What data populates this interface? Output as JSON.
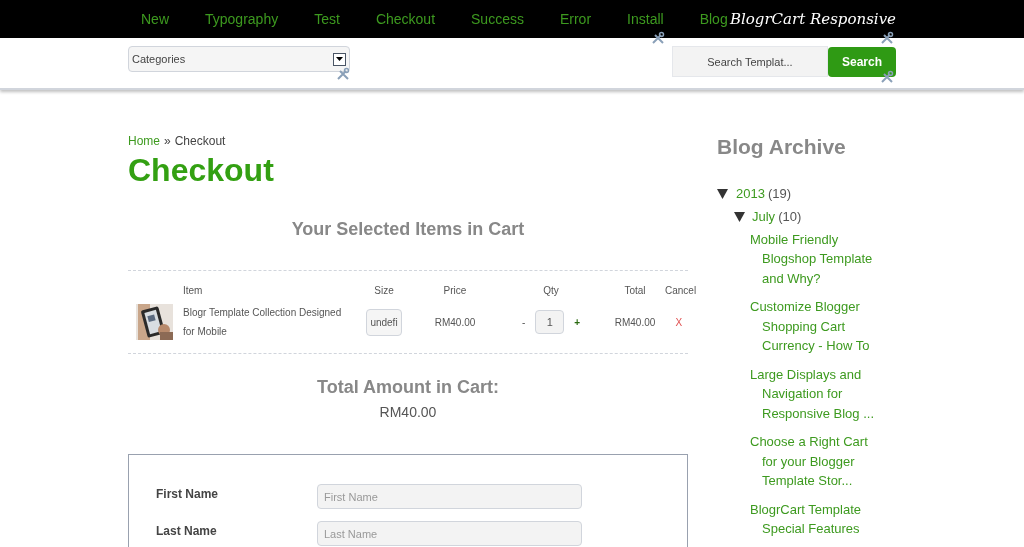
{
  "nav": {
    "links": [
      "New",
      "Typography",
      "Test",
      "Checkout",
      "Success",
      "Error",
      "Install",
      "Blog"
    ],
    "logo": "BlogrCart Responsive"
  },
  "toolbar": {
    "category_select": {
      "value": "Categories"
    },
    "search": {
      "placeholder": "Search Templat...",
      "button": "Search"
    }
  },
  "breadcrumb": {
    "links": [
      "Home"
    ],
    "separator": "»",
    "current": "Checkout"
  },
  "page_title": "Checkout",
  "cart": {
    "heading": "Your Selected Items in Cart",
    "columns": [
      "Item",
      "Size",
      "Price",
      "Qty",
      "Total",
      "Cancel"
    ],
    "rows": [
      {
        "kind": "picture",
        "item": "Blogr Template Collection Designed for Mobile",
        "size": "undefi",
        "price": "RM40.00",
        "decrement": "-",
        "qty": "1",
        "increment": "+",
        "total": "RM40.00",
        "remove": "X"
      }
    ],
    "total_label": "Total Amount in Cart:",
    "total": "RM40.00"
  },
  "form": {
    "fields": [
      {
        "label": "First Name",
        "placeholder": "First Name"
      },
      {
        "label": "Last Name",
        "placeholder": "Last Name"
      }
    ]
  },
  "sidebar": {
    "title": "Blog Archive",
    "archive": [
      {
        "label": "2013",
        "count": "(19)",
        "expanded": true,
        "children": [
          {
            "label": "July",
            "count": "(10)",
            "expanded": true,
            "posts": [
              "Mobile Friendly Blogshop Template and Why?",
              "Customize Blogger Shopping Cart Currency - How To",
              "Large Displays and Navigation for Responsive Blog ...",
              "Choose a Right Cart for your Blogger Template Stor...",
              "BlogrCart Template Special Features"
            ]
          }
        ]
      }
    ]
  }
}
